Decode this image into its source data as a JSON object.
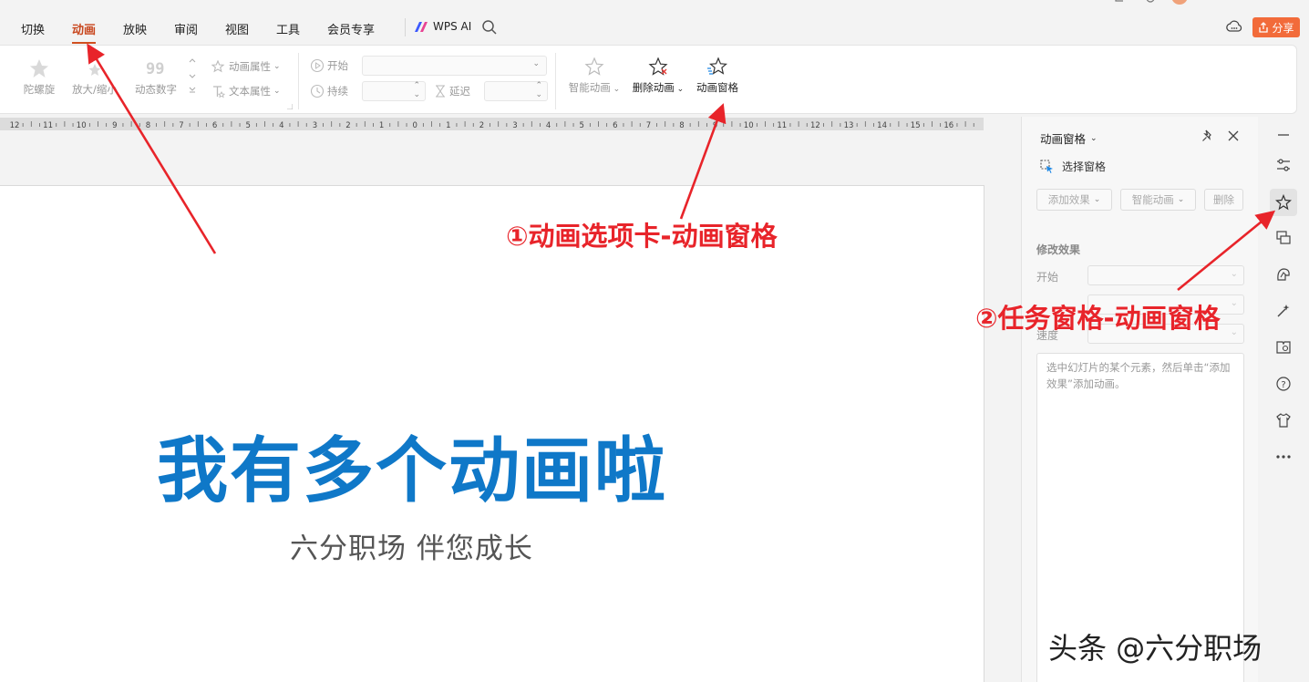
{
  "menu": {
    "tabs": [
      {
        "label": "切换",
        "active": false
      },
      {
        "label": "动画",
        "active": true
      },
      {
        "label": "放映",
        "active": false
      },
      {
        "label": "审阅",
        "active": false
      },
      {
        "label": "视图",
        "active": false
      },
      {
        "label": "工具",
        "active": false
      },
      {
        "label": "会员专享",
        "active": false
      }
    ],
    "wps_ai": "WPS AI",
    "share": "分享",
    "accent": "#d0501f"
  },
  "ribbon": {
    "spiral": "陀螺旋",
    "zoom": "放大/缩小",
    "dynamic_number": "动态数字",
    "anim_props": "动画属性",
    "text_props": "文本属性",
    "start": "开始",
    "duration": "持续",
    "delay": "延迟",
    "smart_anim": "智能动画",
    "delete_anim": "删除动画",
    "anim_pane": "动画窗格"
  },
  "ruler": {
    "labels": [
      "12",
      "11",
      "10",
      "9",
      "8",
      "7",
      "6",
      "5",
      "4",
      "3",
      "2",
      "1",
      "0",
      "1",
      "2",
      "3",
      "4",
      "5",
      "6",
      "7",
      "8",
      "9",
      "10",
      "11",
      "12",
      "13",
      "14",
      "15",
      "16"
    ]
  },
  "slide": {
    "title": "我有多个动画啦",
    "subtitle": "六分职场 伴您成长",
    "title_color": "#0f78c8"
  },
  "annotations": {
    "first": "①动画选项卡-动画窗格",
    "second": "②任务窗格-动画窗格",
    "color": "#e8242a"
  },
  "taskpane": {
    "title": "动画窗格",
    "select_pane": "选择窗格",
    "add_effect": "添加效果",
    "smart_anim": "智能动画",
    "delete": "删除",
    "modify_effect": "修改效果",
    "start_label": "开始",
    "speed_label": "速度",
    "hint": "选中幻灯片的某个元素，然后单击“添加效果”添加动画。"
  },
  "right_strip": {
    "icons": [
      "minimize-icon",
      "sliders-icon",
      "star-animation-icon",
      "comment-icon",
      "design-icon",
      "magic-icon",
      "book-icon",
      "help-icon",
      "shirt-icon",
      "more-icon"
    ],
    "active": "star-animation-icon"
  },
  "watermark": "头条 @六分职场"
}
